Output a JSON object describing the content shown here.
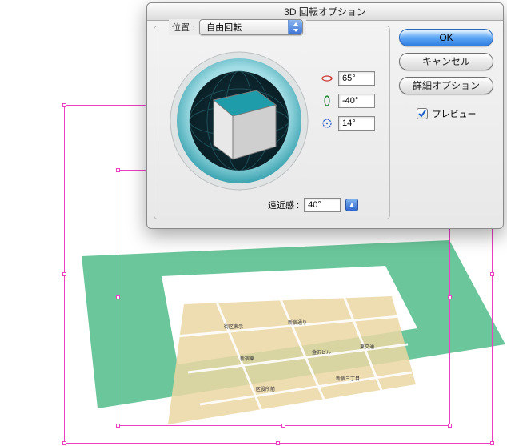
{
  "dialog": {
    "title": "3D 回転オプション",
    "position_label": "位置 :",
    "position_select": {
      "value": "自由回転"
    },
    "rotation": {
      "x": {
        "value": "65°"
      },
      "y": {
        "value": "-40°"
      },
      "z": {
        "value": "14°"
      }
    },
    "perspective": {
      "label": "遠近感 :",
      "value": "40°"
    },
    "buttons": {
      "ok": "OK",
      "cancel": "キャンセル",
      "more": "詳細オプション"
    },
    "preview": {
      "label": "プレビュー",
      "checked": true
    }
  },
  "colors": {
    "green": "#5ec193",
    "beige": "#ecd7a5",
    "teal": "#27a1ae",
    "selection": "#ec3ec2"
  }
}
